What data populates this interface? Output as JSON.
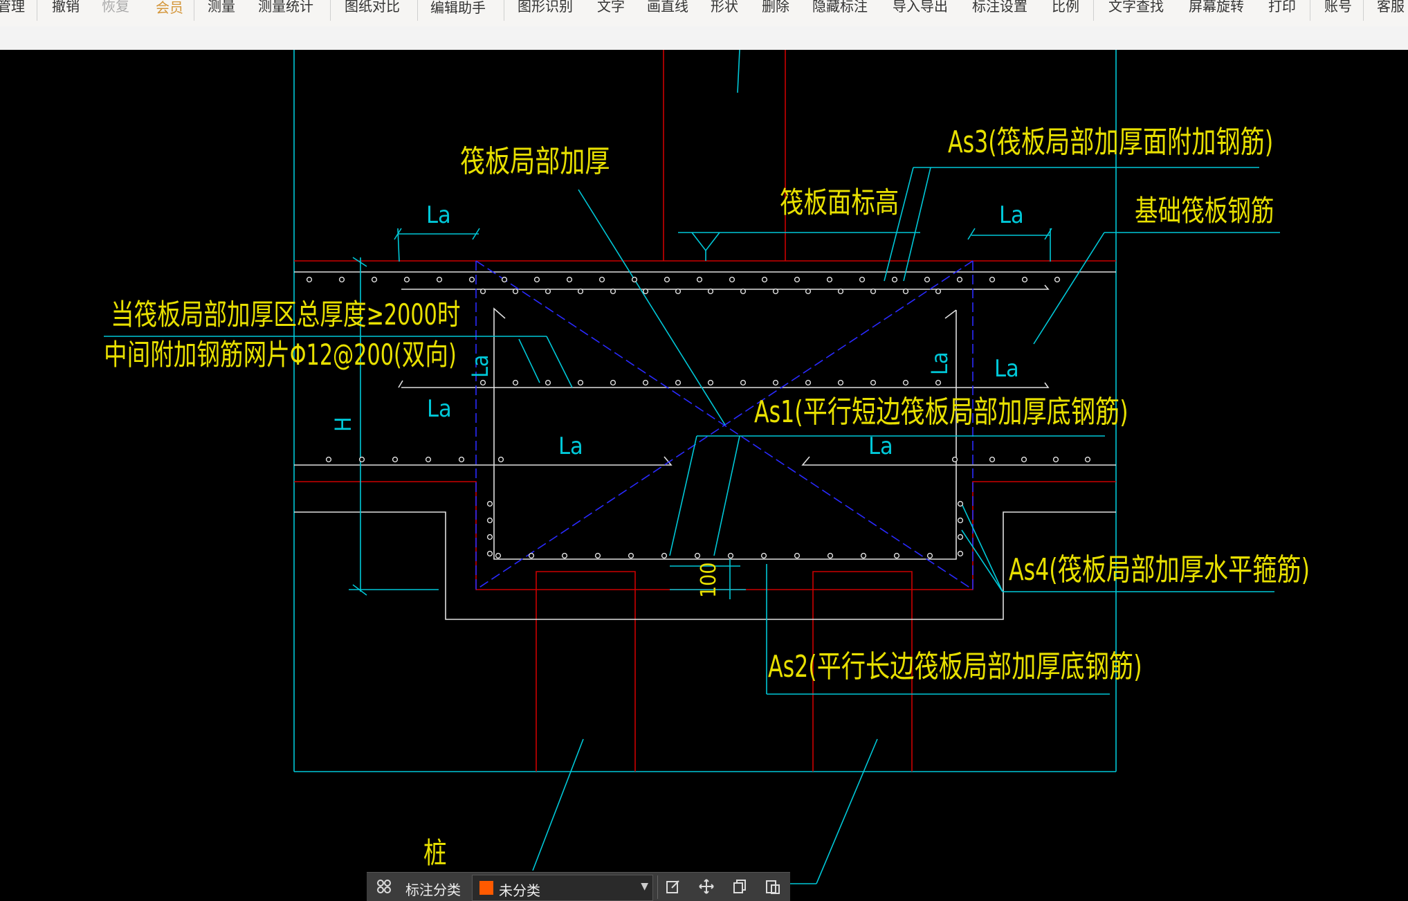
{
  "toolbar": {
    "items": [
      "管理",
      "撤销",
      "恢复",
      "会员",
      "测量",
      "测量统计",
      "图纸对比",
      "编辑助手",
      "图形识别",
      "文字",
      "画直线",
      "形状",
      "删除",
      "隐藏标注",
      "导入导出",
      "标注设置",
      "比例",
      "文字查找",
      "屏幕旋转",
      "打印",
      "账号",
      "客服"
    ]
  },
  "drawing": {
    "labels": {
      "local_thickening": "筏板局部加厚",
      "raft_top_elev": "筏板面标高",
      "as3": "As3(筏板局部加厚面附加钢筋)",
      "base_raft_rebar": "基础筏板钢筋",
      "note_line1": "当筏板局部加厚区总厚度≥2000时",
      "note_line2": "中间附加钢筋网片Φ12@200(双向)",
      "as1": "As1(平行短边筏板局部加厚底钢筋)",
      "as4": "As4(筏板局部加厚水平箍筋)",
      "as2": "As2(平行长边筏板局部加厚底钢筋)",
      "pile": "桩",
      "la": "La",
      "h": "H",
      "dim_100": "100"
    },
    "colors": {
      "annotation": "#e8e000",
      "cyan": "#00c8d8",
      "red": "#cc0000",
      "white": "#ffffff",
      "blue_dashed": "#1a1aff"
    }
  },
  "bottombar": {
    "category_label": "标注分类",
    "category_value": "未分类",
    "swatch_color": "#ff5a00",
    "icons": [
      "grid-icon",
      "edit-icon",
      "move-icon",
      "copy-icon",
      "paste-icon"
    ]
  }
}
